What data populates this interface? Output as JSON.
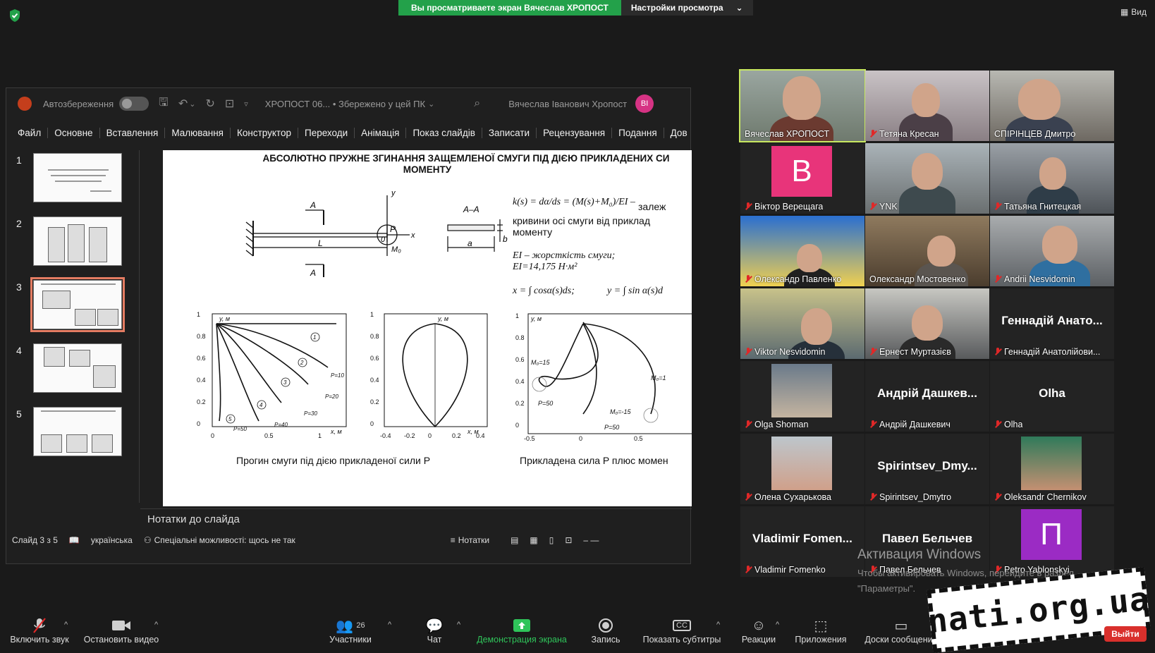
{
  "banner": {
    "sharing_text": "Вы просматриваете экран Вячеслав ХРОПОСТ",
    "settings_label": "Настройки просмотра",
    "view_label": "Вид"
  },
  "powerpoint": {
    "autosave_label": "Автозбереження",
    "doc_title": "ХРОПОСТ 06... • Збережено у цей ПК",
    "user_name": "Вячеслав Іванович Хропост",
    "user_initials": "ВІ",
    "ribbon_tabs": [
      "Файл",
      "Основне",
      "Вставлення",
      "Малювання",
      "Конструктор",
      "Переходи",
      "Анімація",
      "Показ слайдів",
      "Записати",
      "Рецензування",
      "Подання",
      "Дов"
    ],
    "slide_numbers": [
      "1",
      "2",
      "3",
      "4",
      "5"
    ],
    "notes_placeholder": "Нотатки до слайда",
    "status": {
      "slide_counter": "Слайд 3 з 5",
      "language": "українська",
      "accessibility": "Спеціальні можливості: щось не так",
      "notes_button": "Нотатки"
    }
  },
  "slide": {
    "title_line1": "АБСОЛЮТНО ПРУЖНЕ ЗГИНАННЯ ЗАЩЕМЛЕНОЇ СМУГИ ПІД ДІЄЮ ПРИКЛАДЕНИХ СИ",
    "title_line2": "МОМЕНТУ",
    "beam_labels": {
      "a_top": "A",
      "a_bottom": "A",
      "length": "L",
      "y": "y",
      "x": "x",
      "p": "P",
      "zero": "0",
      "m0": "M₀",
      "section": "A–A",
      "width": "a",
      "height": "b"
    },
    "formula_k": "k(s) = dα/ds = (M(s)+M₀)/EI –",
    "dependence_word": "залеж",
    "curve_text_line1": "кривини осі смуги від приклад",
    "curve_text_line2": "моменту",
    "ei_line1": "EI – жорсткість смуги;",
    "ei_line2": "EI=14,175 Н·м²",
    "formula_x": "x = ∫ cosα(s)ds;",
    "formula_y": "y = ∫ sin α(s)d",
    "caption_left": "Прогин смуги під дією прикладеної сили P",
    "caption_right": "Прикладена сила P плюс момен",
    "plot1": {
      "axis_y": "y, м",
      "axis_x": "x, м",
      "yticks": [
        "1",
        "0.8",
        "0.6",
        "0.4",
        "0.2",
        "0"
      ],
      "xticks": [
        "0",
        "0.5",
        "1"
      ],
      "curve_nums": [
        "1",
        "2",
        "3",
        "4",
        "5"
      ],
      "loads": [
        "P=10",
        "P=20",
        "P=30",
        "P=40",
        "P=50"
      ]
    },
    "plot2": {
      "axis_y": "y, м",
      "axis_x": "x, м",
      "yticks": [
        "1",
        "0.8",
        "0.6",
        "0.4",
        "0.2",
        "0"
      ],
      "xticks": [
        "-0.4",
        "-0.2",
        "0",
        "0.2",
        "0.4"
      ]
    },
    "plot3": {
      "axis_y": "y, м",
      "yticks": [
        "1",
        "0.8",
        "0.6",
        "0.4",
        "0.2",
        "0"
      ],
      "xticks": [
        "-0.5",
        "0",
        "0.5"
      ],
      "m15": "M₀=15",
      "p50a": "P=50",
      "m_15": "M₀=-15",
      "p50b": "P=50",
      "m_right": "M₀=1"
    }
  },
  "participants": [
    {
      "name": "Вячеслав ХРОПОСТ",
      "muted": false,
      "active": true
    },
    {
      "name": "Тетяна Кресан",
      "muted": true
    },
    {
      "name": "СПІРІНЦЕВ Дмитро",
      "muted": false
    },
    {
      "name": "Віктор Верещага",
      "muted": true,
      "avatar_letter": "B"
    },
    {
      "name": "YNK",
      "muted": true
    },
    {
      "name": "Татьяна Гнитецкая",
      "muted": true
    },
    {
      "name": "Олександр Павленко",
      "muted": true
    },
    {
      "name": "Олександр Мостовенко",
      "muted": false
    },
    {
      "name": "Andrii Nesvidomin",
      "muted": true
    },
    {
      "name": "Viktor Nesvidomin",
      "muted": true
    },
    {
      "name": "Ернест Муртазієв",
      "muted": true
    },
    {
      "name": "Геннадій Анатолійови...",
      "muted": true,
      "big_name": "Геннадій Анато..."
    },
    {
      "name": "Olga Shoman",
      "muted": true
    },
    {
      "name": "Андрій Дашкевич",
      "muted": true,
      "big_name": "Андрій Дашкев..."
    },
    {
      "name": "Olha",
      "muted": true,
      "big_name": "Olha"
    },
    {
      "name": "Олена Сухарькова",
      "muted": true
    },
    {
      "name": "Spirintsev_Dmytro",
      "muted": true,
      "big_name": "Spirintsev_Dmy..."
    },
    {
      "name": "Oleksandr Chernikov",
      "muted": true
    },
    {
      "name": "Vladimir Fomenko",
      "muted": true,
      "big_name": "Vladimir Fomen..."
    },
    {
      "name": "Павел Бельчев",
      "muted": true,
      "big_name": "Павел Бельчев"
    },
    {
      "name": "Petro Yablonskyi",
      "muted": true,
      "avatar_letter": "П"
    }
  ],
  "overlay_text": {
    "activation_title": "Активация Windows",
    "activation_sub1": "Чтобы активировать Windows, перейдите в раздел",
    "activation_sub2": "\"Параметры\"."
  },
  "toolbar": {
    "unmute": "Включить звук",
    "stop_video": "Остановить видео",
    "participants": "Участники",
    "participants_count": "26",
    "chat": "Чат",
    "share_screen": "Демонстрация экрана",
    "record": "Запись",
    "captions": "Показать субтитры",
    "captions_icon_text": "CC",
    "reactions": "Реакции",
    "apps": "Приложения",
    "boards": "Доски сообщений",
    "exit": "Выйти"
  },
  "watermark": "nati.org.ua",
  "colors": {
    "accent_green": "#23a14a",
    "active_tile": "#c8e860",
    "exit_red": "#d9302c",
    "avatar_pink": "#e8347a",
    "avatar_purple": "#9b2bc4"
  }
}
